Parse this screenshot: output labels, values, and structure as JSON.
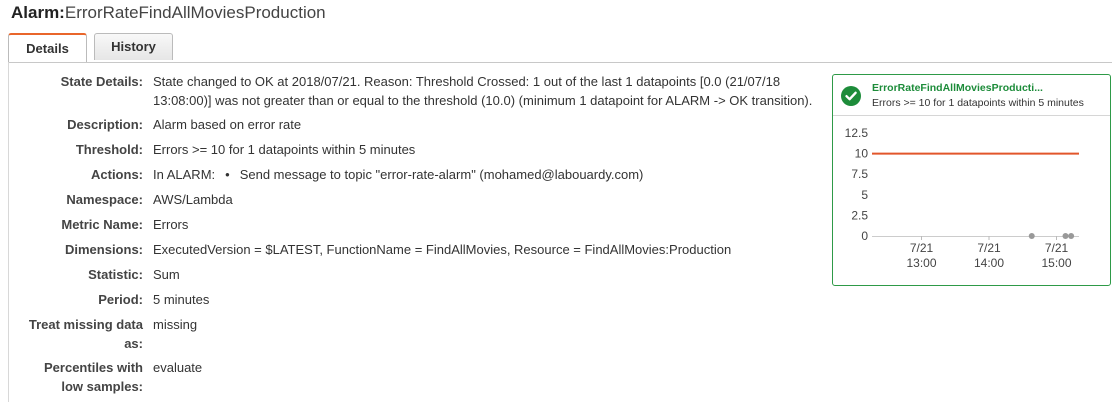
{
  "header": {
    "prefix": "Alarm:",
    "alarm_name": "ErrorRateFindAllMoviesProduction"
  },
  "tabs": [
    {
      "label": "Details",
      "active": true
    },
    {
      "label": "History",
      "active": false
    }
  ],
  "details": {
    "state_details": {
      "label": "State Details:",
      "line1": "State changed to OK at 2018/07/21. Reason: Threshold Crossed: 1 out of the last 1 datapoints [0.0 (21/07/18",
      "line2": "13:08:00)] was not greater than or equal to the threshold (10.0) (minimum 1 datapoint for ALARM -> OK transition)."
    },
    "description": {
      "label": "Description:",
      "value": "Alarm based on error rate"
    },
    "threshold": {
      "label": "Threshold:",
      "value": "Errors >= 10 for 1 datapoints within 5 minutes"
    },
    "actions": {
      "label": "Actions:",
      "state": "In ALARM:",
      "bullet": "•",
      "value": "Send message to topic \"error-rate-alarm\" (mohamed@labouardy.com)"
    },
    "namespace": {
      "label": "Namespace:",
      "value": "AWS/Lambda"
    },
    "metric_name": {
      "label": "Metric Name:",
      "value": "Errors"
    },
    "dimensions": {
      "label": "Dimensions:",
      "value": "ExecutedVersion = $LATEST, FunctionName = FindAllMovies, Resource = FindAllMovies:Production"
    },
    "statistic": {
      "label": "Statistic:",
      "value": "Sum"
    },
    "period": {
      "label": "Period:",
      "value": "5 minutes"
    },
    "treat_missing": {
      "label_line1": "Treat missing data",
      "label_line2": "as:",
      "value": "missing"
    },
    "percentiles": {
      "label_line1": "Percentiles with",
      "label_line2": "low samples:",
      "value": "evaluate"
    }
  },
  "widget": {
    "title": "ErrorRateFindAllMoviesProducti...",
    "subtitle": "Errors >= 10 for 1 datapoints within 5 minutes",
    "status_color": "#1d8c3a",
    "icon": "check-icon"
  },
  "chart_data": {
    "type": "line",
    "title": "",
    "xlabel": "",
    "ylabel": "",
    "ylim": [
      0,
      12.5
    ],
    "y_ticks": [
      "12.5",
      "10",
      "7.5",
      "5",
      "2.5",
      "0"
    ],
    "x_ticks": [
      {
        "date": "7/21",
        "time": "13:00"
      },
      {
        "date": "7/21",
        "time": "14:00"
      },
      {
        "date": "7/21",
        "time": "15:00"
      }
    ],
    "xlim_minutes": [
      "12:16",
      "15:20"
    ],
    "threshold": {
      "value": 10,
      "color": "#e2562b"
    },
    "series": [
      {
        "color": "#999999",
        "points": [
          {
            "x": "14:38",
            "y": 0
          },
          {
            "x": "15:08",
            "y": 0
          },
          {
            "x": "15:13",
            "y": 0
          }
        ]
      }
    ],
    "grid": false
  }
}
